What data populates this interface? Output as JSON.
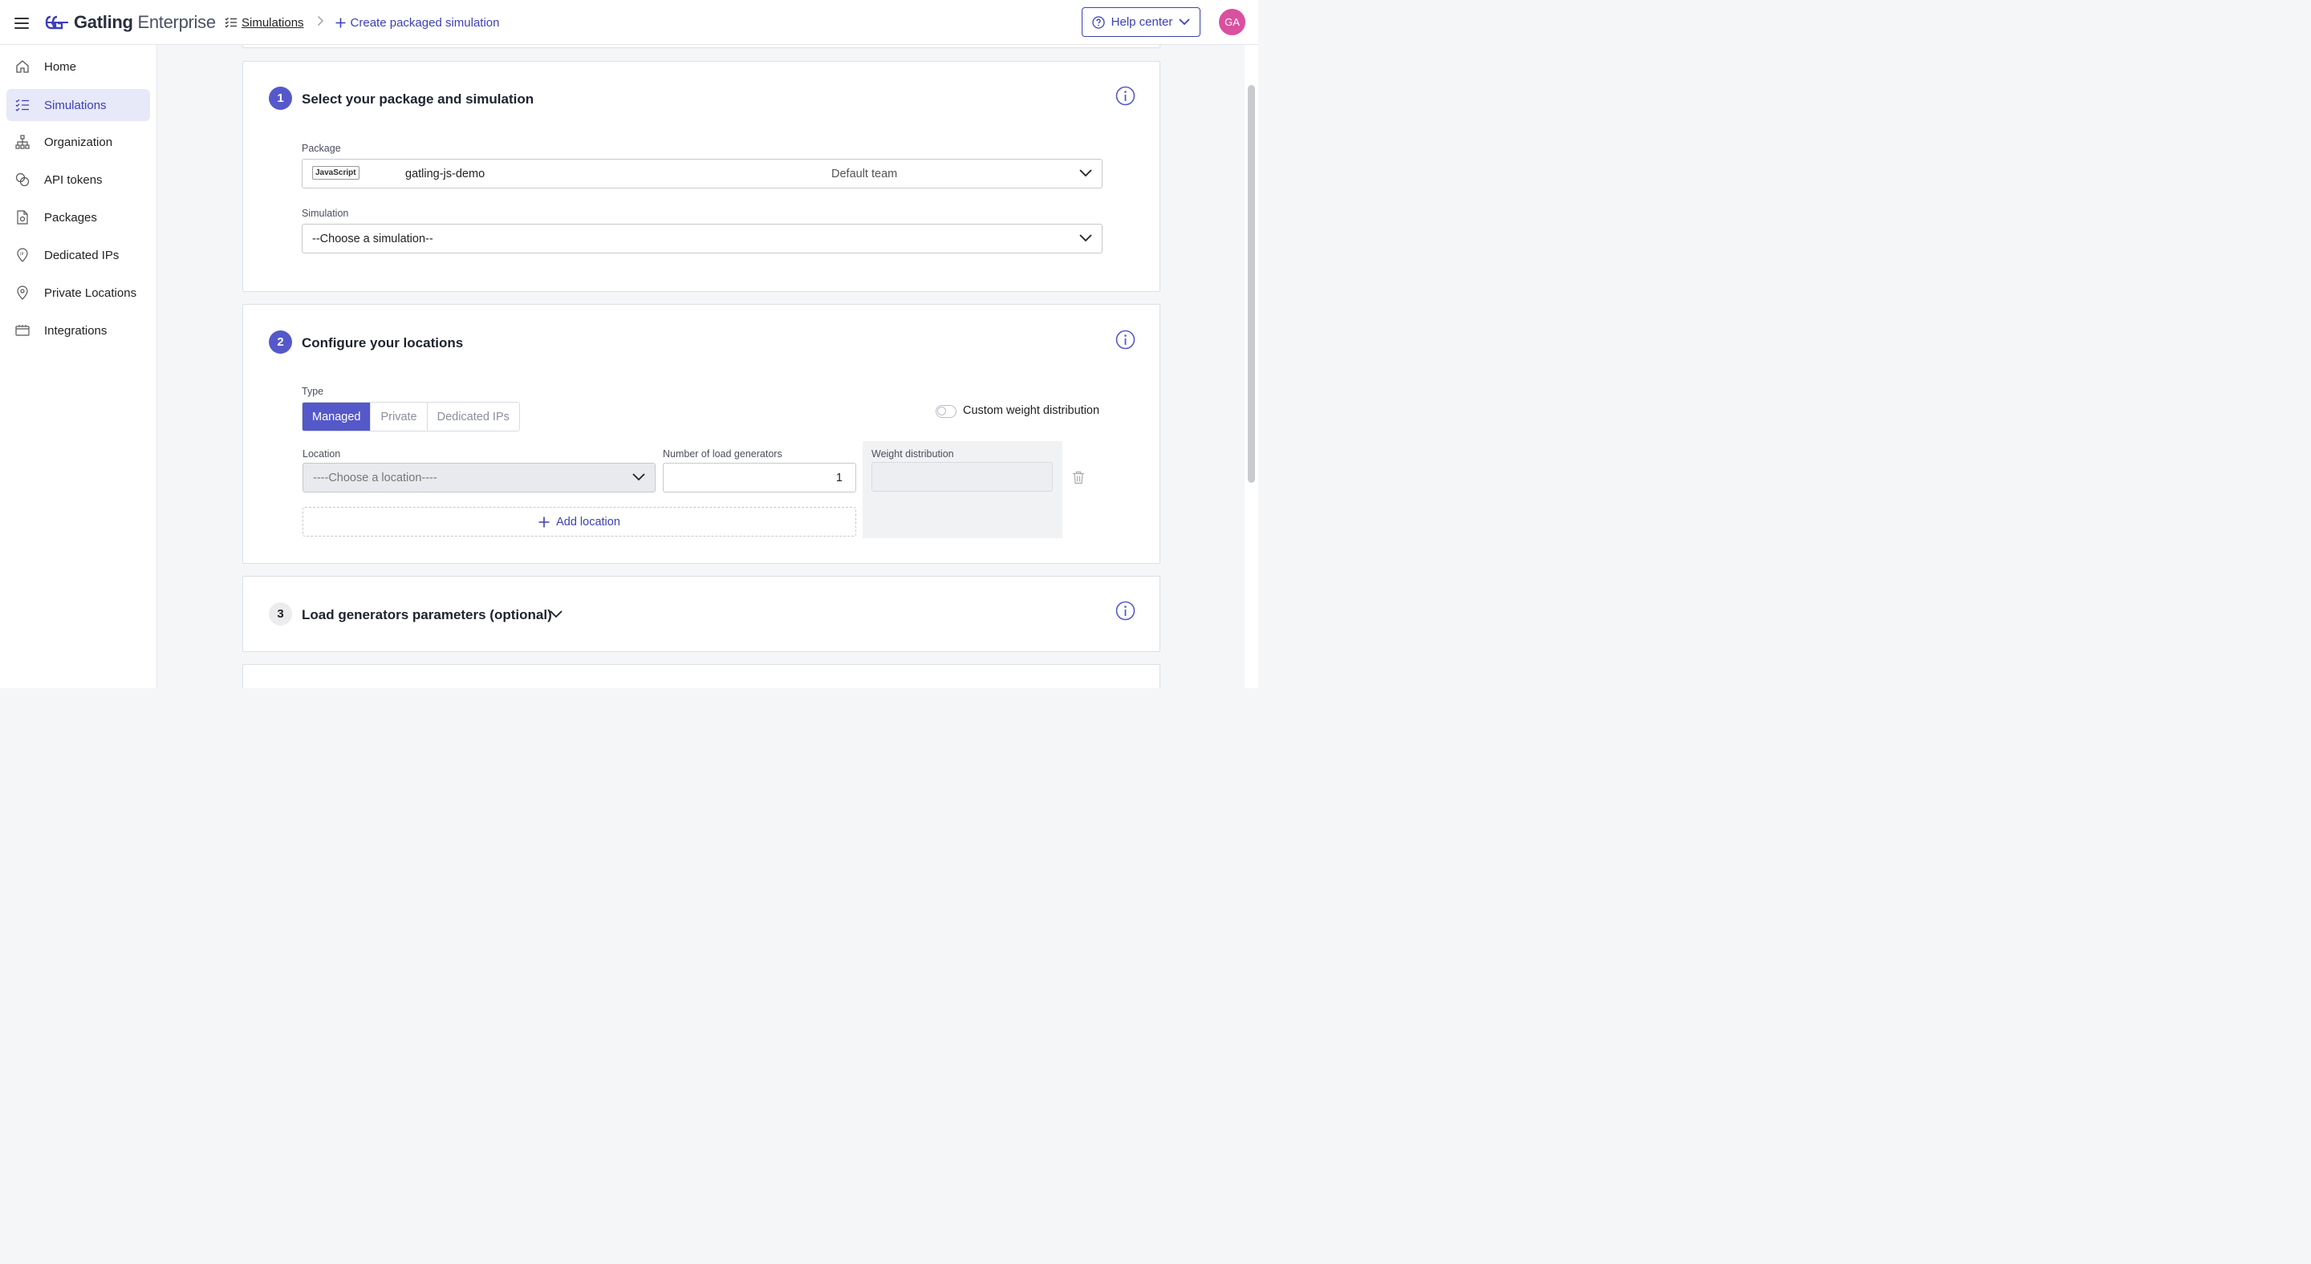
{
  "header": {
    "logo_brand": "Gatling",
    "logo_product": "Enterprise",
    "breadcrumb_simulations": "Simulations",
    "breadcrumb_current": "Create packaged simulation",
    "help_center": "Help center",
    "avatar_initials": "GA"
  },
  "sidebar": {
    "items": [
      {
        "label": "Home",
        "icon": "home-icon"
      },
      {
        "label": "Simulations",
        "icon": "simulations-icon",
        "active": true
      },
      {
        "label": "Organization",
        "icon": "organization-icon"
      },
      {
        "label": "API tokens",
        "icon": "api-tokens-icon"
      },
      {
        "label": "Packages",
        "icon": "packages-icon"
      },
      {
        "label": "Dedicated IPs",
        "icon": "dedicated-ips-icon"
      },
      {
        "label": "Private Locations",
        "icon": "private-locations-icon"
      },
      {
        "label": "Integrations",
        "icon": "integrations-icon"
      }
    ]
  },
  "step1": {
    "number": "1",
    "title": "Select your package and simulation",
    "package_label": "Package",
    "package_language": "JavaScript",
    "package_name": "gatling-js-demo",
    "package_team": "Default team",
    "simulation_label": "Simulation",
    "simulation_value": "--Choose a simulation--"
  },
  "step2": {
    "number": "2",
    "title": "Configure your locations",
    "type_label": "Type",
    "type_options": [
      "Managed",
      "Private",
      "Dedicated IPs"
    ],
    "custom_weight_label": "Custom weight distribution",
    "location_label": "Location",
    "location_value": "----Choose a location----",
    "generators_label": "Number of load generators",
    "generators_value": "1",
    "weight_label": "Weight distribution",
    "add_location": "Add location"
  },
  "step3": {
    "number": "3",
    "title": "Load generators parameters (optional)"
  },
  "colors": {
    "accent": "#5558c9",
    "link": "#3b3fb6",
    "avatar": "#d9509f"
  }
}
